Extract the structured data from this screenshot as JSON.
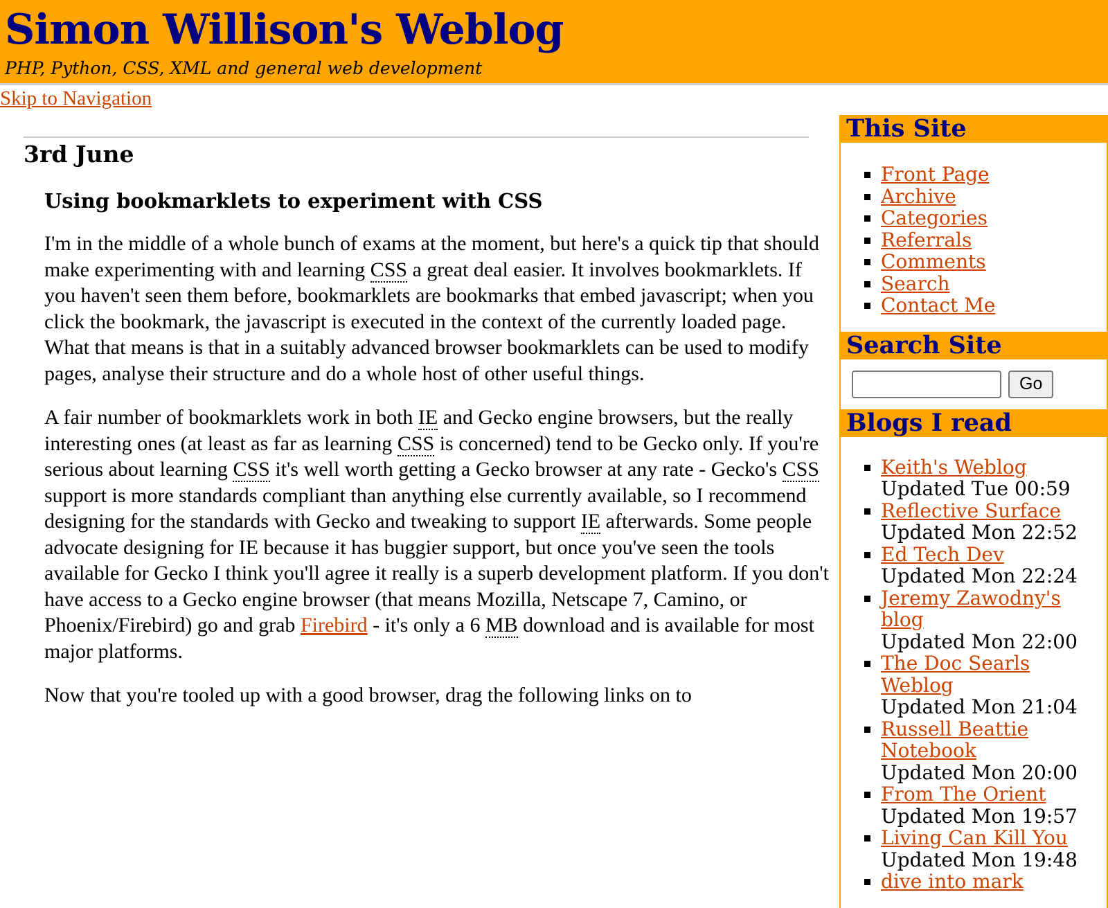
{
  "header": {
    "title": "Simon Willison's Weblog",
    "tagline": "PHP, Python, CSS, XML and general web development"
  },
  "skip_link": "Skip to Navigation",
  "main": {
    "date_heading": "3rd June",
    "post_title": "Using bookmarklets to experiment with CSS",
    "paragraphs": {
      "p1": {
        "a": "I'm in the middle of a whole bunch of exams at the moment, but here's a quick tip that should make experimenting with and learning ",
        "abbr1": "CSS",
        "b": " a great deal easier. It involves bookmarklets. If you haven't seen them before, bookmarklets are bookmarks that embed javascript; when you click the bookmark, the javascript is executed in the context of the currently loaded page. What that means is that in a suitably advanced browser bookmarklets can be used to modify pages, analyse their structure and do a whole host of other useful things."
      },
      "p2": {
        "a": "A fair number of bookmarklets work in both ",
        "abbr1": "IE",
        "b": " and Gecko engine browsers, but the really interesting ones (at least as far as learning ",
        "abbr2": "CSS",
        "c": " is concerned) tend to be Gecko only. If you're serious about learning ",
        "abbr3": "CSS",
        "d": " it's well worth getting a Gecko browser at any rate - Gecko's ",
        "abbr4": "CSS",
        "e": " support is more standards compliant than anything else currently available, so I recommend designing for the standards with Gecko and tweaking to support ",
        "abbr5": "IE",
        "f": " afterwards. Some people advocate designing for IE because it has buggier support, but once you've seen the tools available for Gecko I think you'll agree it really is a superb development platform. If you don't have access to a Gecko engine browser (that means Mozilla, Netscape 7, Camino, or Phoenix/Firebird) go and grab ",
        "link": "Firebird",
        "g": " - it's only a 6 ",
        "abbr6": "MB",
        "h": " download and is available for most major platforms."
      },
      "p3": "Now that you're tooled up with a good browser, drag the following links on to"
    }
  },
  "sidebar": {
    "this_site": {
      "heading": "This Site",
      "items": [
        "Front Page",
        "Archive",
        "Categories",
        "Referrals",
        "Comments",
        "Search",
        "Contact Me"
      ]
    },
    "search": {
      "heading": "Search Site",
      "input_value": "",
      "button_label": "Go"
    },
    "blogs": {
      "heading": "Blogs I read",
      "items": [
        {
          "name": "Keith's Weblog",
          "updated": "Updated Tue 00:59"
        },
        {
          "name": "Reflective Surface",
          "updated": "Updated Mon 22:52"
        },
        {
          "name": "Ed Tech Dev",
          "updated": "Updated Mon 22:24"
        },
        {
          "name": "Jeremy Zawodny's blog",
          "updated": "Updated Mon 22:00"
        },
        {
          "name": "The Doc Searls Weblog",
          "updated": "Updated Mon 21:04"
        },
        {
          "name": "Russell Beattie Notebook",
          "updated": "Updated Mon 20:00"
        },
        {
          "name": "From The Orient",
          "updated": "Updated Mon 19:57"
        },
        {
          "name": "Living Can Kill You",
          "updated": "Updated Mon 19:48"
        },
        {
          "name": "dive into mark",
          "updated": ""
        }
      ]
    }
  },
  "colors": {
    "header_bg": "#ffa500",
    "title_color": "#000080",
    "link_color": "#cc4400",
    "divider": "#cccccc"
  }
}
